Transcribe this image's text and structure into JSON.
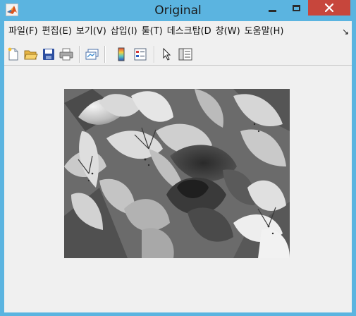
{
  "window": {
    "title": "Original"
  },
  "icons": {
    "app": "matlab-logo-icon",
    "minimize": "minimize-icon",
    "maximize": "maximize-icon",
    "close": "close-icon"
  },
  "menu": {
    "items": [
      {
        "label": "파일(F)"
      },
      {
        "label": "편집(E)"
      },
      {
        "label": "보기(V)"
      },
      {
        "label": "삽입(I)"
      },
      {
        "label": "툴(T)"
      },
      {
        "label": "데스크탑(D"
      },
      {
        "label": "창(W)"
      },
      {
        "label": "도움말(H)"
      }
    ],
    "overflow": "↘"
  },
  "toolbar": {
    "buttons": [
      {
        "icon": "new-figure-icon"
      },
      {
        "icon": "open-file-icon"
      },
      {
        "icon": "save-icon"
      },
      {
        "icon": "print-icon"
      },
      {
        "icon": "link-plot-icon"
      },
      {
        "icon": "colorbar-icon"
      },
      {
        "icon": "legend-icon"
      },
      {
        "icon": "pointer-icon"
      },
      {
        "icon": "property-inspector-icon"
      }
    ]
  },
  "figure": {
    "image_description_colors": {
      "close_button": "#c7463c",
      "title_bar": "#5bb4e0",
      "background": "#f0f0f0"
    }
  }
}
